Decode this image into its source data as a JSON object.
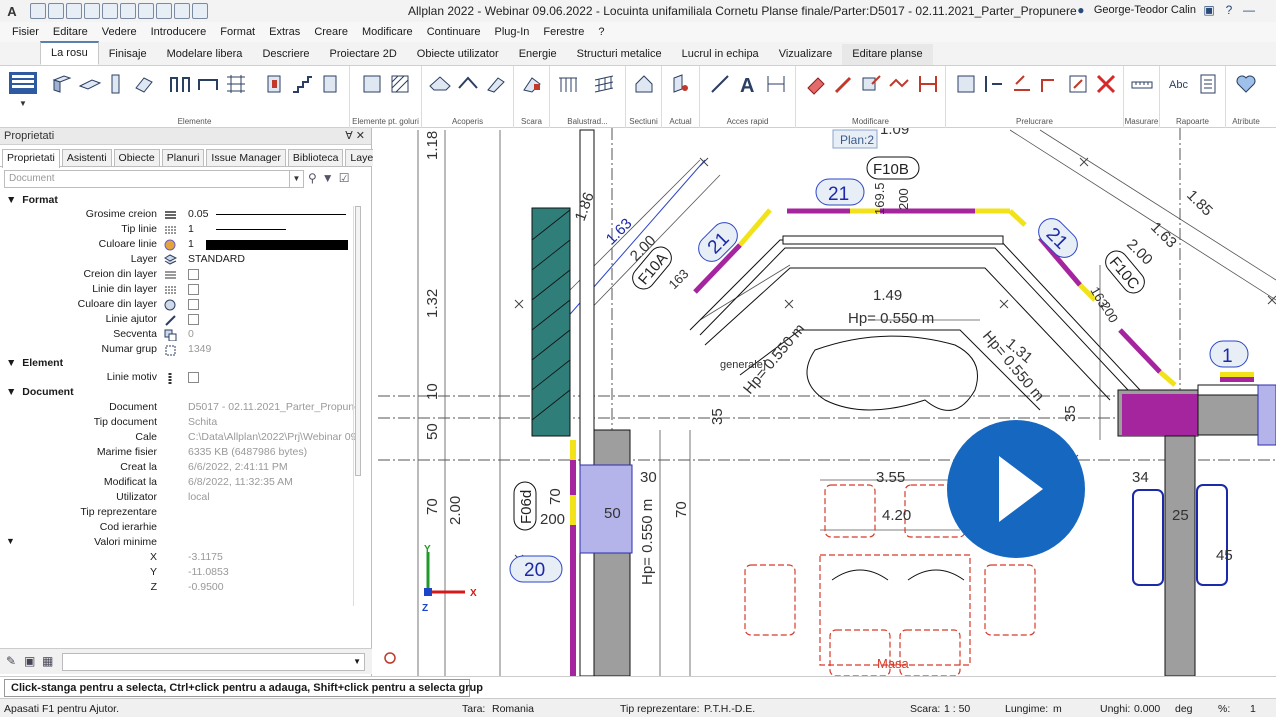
{
  "app": {
    "logo": "A",
    "title": "Allplan 2022 - Webinar 09.06.2022 - Locuinta unifamiliala Cornetu Planse finale/Parter:D5017 - 02.11.2021_Parter_Propunere",
    "user": "George-Teodor Calin"
  },
  "menu": [
    "Fisier",
    "Editare",
    "Vedere",
    "Introducere",
    "Format",
    "Extras",
    "Creare",
    "Modificare",
    "Continuare",
    "Plug-In",
    "Ferestre",
    "?"
  ],
  "ribbon_tabs": [
    "La rosu",
    "Finisaje",
    "Modelare libera",
    "Descriere",
    "Proiectare 2D",
    "Obiecte utilizator",
    "Energie",
    "Structuri metalice",
    "Lucrul in echipa",
    "Vizualizare",
    "Editare planse"
  ],
  "ribbon_active_tab": "La rosu",
  "ribbon_groups": [
    "Elemente",
    "Elemente pt. goluri",
    "Acoperis",
    "Scara",
    "Balustrad...",
    "Sectiuni",
    "Actual",
    "Acces rapid",
    "Modificare",
    "Prelucrare",
    "Masurare",
    "Rapoarte",
    "Atribute"
  ],
  "panel": {
    "title": "Proprietati",
    "tabs": [
      "Proprietati",
      "Asistenti",
      "Obiecte",
      "Planuri",
      "Issue Manager",
      "Biblioteca",
      "Layer"
    ],
    "filter_placeholder": "Document",
    "sections": {
      "format": "Format",
      "element": "Element",
      "document": "Document"
    },
    "format_rows": [
      {
        "k": "Grosime creion",
        "v": "0.05"
      },
      {
        "k": "Tip linie",
        "v": "1"
      },
      {
        "k": "Culoare linie",
        "v": "1"
      },
      {
        "k": "Layer",
        "v": "STANDARD"
      },
      {
        "k": "Creion din layer",
        "v": ""
      },
      {
        "k": "Linie din layer",
        "v": ""
      },
      {
        "k": "Culoare din layer",
        "v": ""
      },
      {
        "k": "Linie ajutor",
        "v": ""
      },
      {
        "k": "Secventa",
        "v": "0"
      },
      {
        "k": "Numar grup",
        "v": "1349"
      }
    ],
    "element_rows": [
      {
        "k": "Linie motiv",
        "v": ""
      }
    ],
    "document_rows": [
      {
        "k": "Document",
        "v": "D5017 - 02.11.2021_Parter_Propuner"
      },
      {
        "k": "Tip document",
        "v": "Schita"
      },
      {
        "k": "Cale",
        "v": "C:\\Data\\Allplan\\2022\\Prj\\Webinar 09"
      },
      {
        "k": "Marime fisier",
        "v": "6335 KB (6487986 bytes)"
      },
      {
        "k": "Creat la",
        "v": "6/6/2022, 2:41:11 PM"
      },
      {
        "k": "Modificat la",
        "v": "6/8/2022, 11:32:35 AM"
      },
      {
        "k": "Utilizator",
        "v": "local"
      },
      {
        "k": "Tip reprezentare",
        "v": ""
      },
      {
        "k": "Cod ierarhie",
        "v": ""
      }
    ],
    "min_values_label": "Valori minime",
    "min_values": [
      {
        "k": "X",
        "v": "-3.1175"
      },
      {
        "k": "Y",
        "v": "-11.0853"
      },
      {
        "k": "Z",
        "v": "-0.9500"
      }
    ]
  },
  "drawing": {
    "plan_label": "Plan:2",
    "labels": {
      "d21a": "21",
      "d21b": "21",
      "d21c": "21",
      "d1": "1",
      "d20": "20",
      "f10b": "F10B",
      "f10a": "F10A",
      "f10c": "F10C",
      "f06d": "F06d",
      "m1": "1.18",
      "m2": "1.32",
      "m3": "10",
      "m4": "50",
      "m5": "70",
      "m6": "2.00",
      "m7": "1.86",
      "m8": "1.63",
      "m9": "2.00",
      "m10": "163",
      "m11": "169.5",
      "m12": "200",
      "m13": "1.85",
      "m14": "1.63",
      "m15": "2.00",
      "m16": "163",
      "m17": "200",
      "m18": "1.49",
      "m19": "Hp= 0.550 m",
      "m20": "Hp= 0.550 m",
      "m21": "Hp= 0.550 m",
      "m22": "1.31",
      "m23": "35",
      "m24": "35",
      "m25": "3.55",
      "m26": "4.20",
      "m27": "30",
      "m28": "70",
      "m29": "200",
      "m30": "50",
      "m31": "Hp= 0.550 m",
      "m32": "70",
      "m33": "34",
      "m34": "25",
      "m35": "45",
      "m36": "1.09",
      "generale": "generale]",
      "masa": "Masa"
    }
  },
  "hint": "Click-stanga pentru a selecta, Ctrl+click pentru a adauga, Shift+click pentru a selecta grup",
  "status": {
    "help": "Apasati F1 pentru Ajutor.",
    "tara_label": "Tara:",
    "tara": "Romania",
    "tip_label": "Tip reprezentare:",
    "tip": "P.T.H.-D.E.",
    "scara_label": "Scara:",
    "scara": "1 : 50",
    "lungime_label": "Lungime:",
    "lungime": "m",
    "unghi_label": "Unghi:",
    "unghi": "0.000",
    "unghi_unit": "deg",
    "pct_label": "%:",
    "pct": "1"
  },
  "colors": {
    "accent": "#1667c0",
    "magenta": "#a4259d",
    "yellow": "#f2e21a",
    "teal": "#2f7e79",
    "redline": "#d63b2a",
    "blueline": "#2b45c8"
  }
}
